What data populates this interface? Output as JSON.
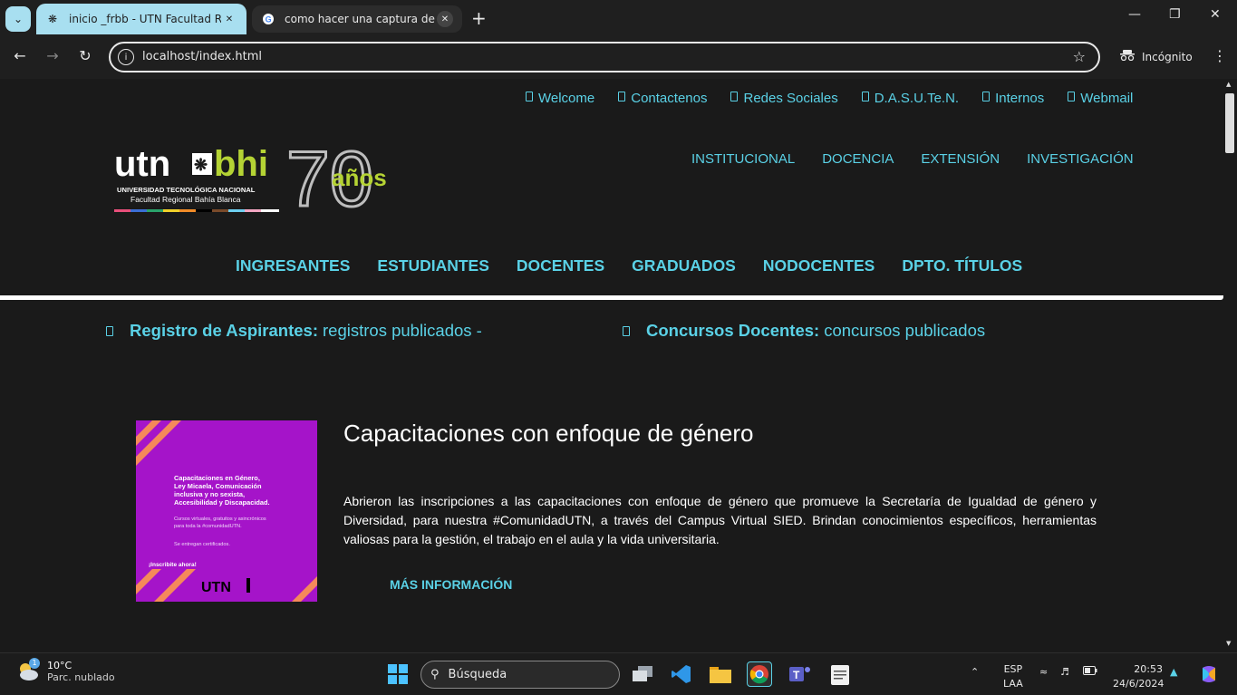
{
  "browser": {
    "tabs": [
      {
        "title": "inicio _frbb - UTN Facultad Regi",
        "active": true
      },
      {
        "title": "como hacer una captura de pan",
        "active": false
      }
    ],
    "new_tab_label": "+",
    "url": "localhost/index.html",
    "incognito_label": "Incógnito"
  },
  "site": {
    "top_links": [
      "Welcome",
      "Contactenos",
      "Redes Sociales",
      "D.A.S.U.Te.N.",
      "Internos",
      "Webmail"
    ],
    "logo": {
      "brand_left": "utn",
      "brand_right": "bhi",
      "line1": "UNIVERSIDAD TECNOLÓGICA NACIONAL",
      "line2": "Facultad Regional Bahía Blanca",
      "anniversary_number": "70",
      "anniversary_text": "años"
    },
    "main_nav": [
      "INSTITUCIONAL",
      "DOCENCIA",
      "EXTENSIÓN",
      "INVESTIGACIÓN"
    ],
    "secondary_nav": [
      "INGRESANTES",
      "ESTUDIANTES",
      "DOCENTES",
      "GRADUADOS",
      "NODOCENTES",
      "DPTO. TÍTULOS"
    ],
    "ticker": [
      {
        "label": "Registro de Aspirantes:",
        "text": "registros publicados -"
      },
      {
        "label": "Concursos Docentes:",
        "text": "concursos publicados"
      }
    ],
    "news": {
      "title": "Capacitaciones con enfoque de género",
      "body": "Abrieron las inscripciones a las capacitaciones con enfoque de género que promueve la Secretaría de Igualdad de género y Diversidad, para nuestra #ComunidadUTN, a través del Campus Virtual SIED. Brindan conocimientos específicos, herramientas valiosas para la gestión, el trabajo en el aula y la vida universitaria.",
      "more_label": "MÁS INFORMACIÓN",
      "image": {
        "heading": "Capacitaciones en Género, Ley Micaela, Comunicación inclusiva y no sexista, Accesibilidad y Discapacidad.",
        "sub": "Cursos virtuales, gratuitos y asincrónicos para toda la #comunidadUTN.",
        "cert": "Se entregan certificados.",
        "cta": "¡Inscribite ahora!",
        "brand": "UTN"
      }
    }
  },
  "taskbar": {
    "weather_temp": "10°C",
    "weather_desc": "Parc. nublado",
    "weather_badge": "1",
    "search_label": "Búsqueda",
    "lang_top": "ESP",
    "lang_bottom": "LAA",
    "time": "20:53",
    "date": "24/6/2024"
  },
  "colors": {
    "accent": "#5ad1e6",
    "tab_active": "#a8dff0",
    "page_bg": "#1a1a1a",
    "news_image_bg": "#a514c9",
    "brand_green": "#b5d334"
  }
}
